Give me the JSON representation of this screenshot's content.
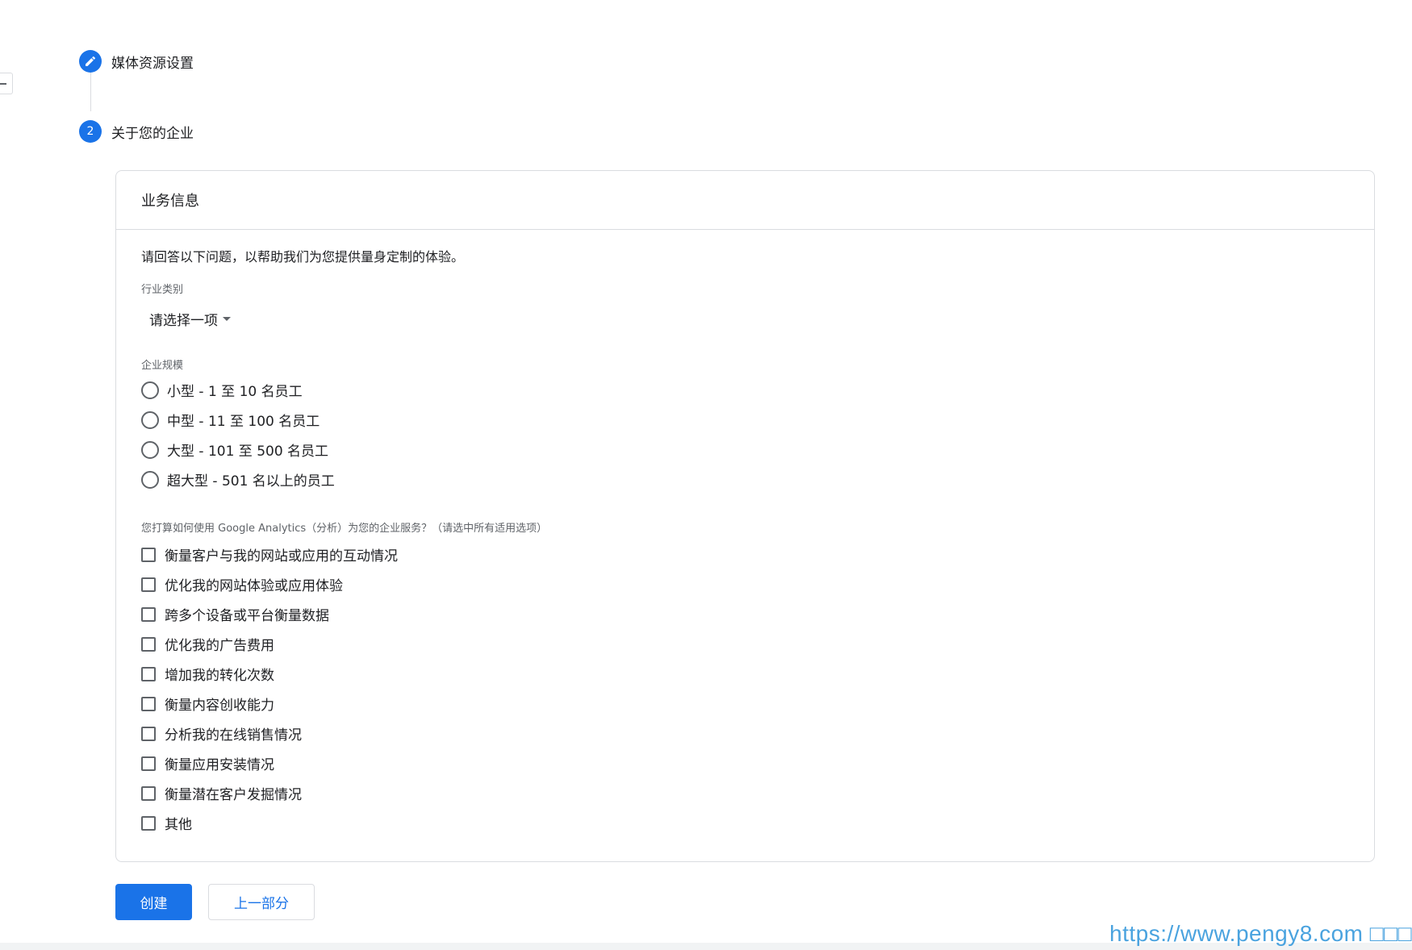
{
  "stepper": {
    "step1": {
      "label": "媒体资源设置"
    },
    "step2": {
      "number": "2",
      "label": "关于您的企业"
    }
  },
  "card": {
    "title": "业务信息",
    "intro": "请回答以下问题，以帮助我们为您提供量身定制的体验。",
    "industry": {
      "label": "行业类别",
      "selected": "请选择一项"
    },
    "size": {
      "label": "企业规模",
      "options": [
        "小型 - 1 至 10 名员工",
        "中型 - 11 至 100 名员工",
        "大型 - 101 至 500 名员工",
        "超大型 - 501 名以上的员工"
      ]
    },
    "usage": {
      "label": "您打算如何使用 Google Analytics（分析）为您的企业服务？（请选中所有适用选项）",
      "options": [
        "衡量客户与我的网站或应用的互动情况",
        "优化我的网站体验或应用体验",
        "跨多个设备或平台衡量数据",
        "优化我的广告费用",
        "增加我的转化次数",
        "衡量内容创收能力",
        "分析我的在线销售情况",
        "衡量应用安装情况",
        "衡量潜在客户发掘情况",
        "其他"
      ]
    }
  },
  "actions": {
    "create": "创建",
    "previous": "上一部分"
  },
  "watermark": "https://www.pengy8.com □□□"
}
